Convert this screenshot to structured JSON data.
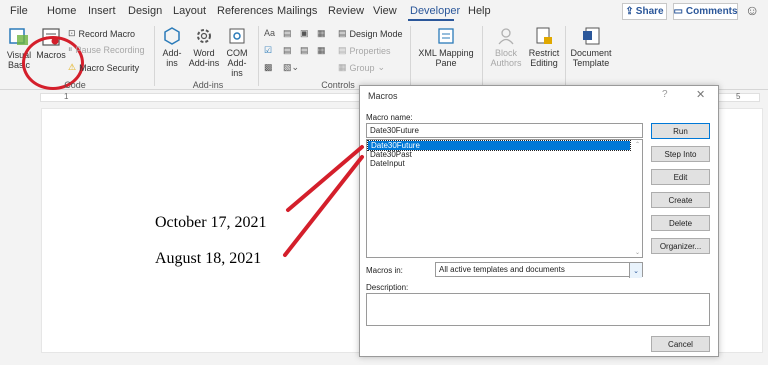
{
  "menu": {
    "items": [
      "File",
      "Home",
      "Insert",
      "Design",
      "Layout",
      "References",
      "Mailings",
      "Review",
      "View",
      "Developer",
      "Help"
    ],
    "active": "Developer",
    "share_label": "Share",
    "comments_label": "Comments"
  },
  "ribbon": {
    "visual_basic": "Visual Basic",
    "macros": "Macros",
    "record_macro": "Record Macro",
    "pause_recording": "Pause Recording",
    "macro_security": "Macro Security",
    "add_ins": "Add-ins",
    "word_add_ins": "Word Add-ins",
    "com_add_ins": "COM Add-ins",
    "design_mode": "Design Mode",
    "properties": "Properties",
    "group": "Group",
    "xml_mapping_pane": "XML Mapping Pane",
    "block_authors": "Block Authors",
    "restrict_editing": "Restrict Editing",
    "document_template": "Document Template",
    "group_labels": {
      "code": "Code",
      "add_ins": "Add-ins",
      "controls": "Controls"
    }
  },
  "ruler": {
    "left_num": "1",
    "right_num": "5"
  },
  "document": {
    "line1": "October 17, 2021",
    "line2": "August 18, 2021"
  },
  "dialog": {
    "title": "Macros",
    "help": "?",
    "close": "✕",
    "macro_name_label": "Macro name:",
    "macro_name_value": "Date30Future",
    "macros": [
      "Date30Future",
      "Date30Past",
      "DateInput"
    ],
    "selected_index": 0,
    "macros_in_label": "Macros in:",
    "macros_in_value": "All active templates and documents",
    "description_label": "Description:",
    "buttons": {
      "run": "Run",
      "step_into": "Step Into",
      "edit": "Edit",
      "create": "Create",
      "delete": "Delete",
      "organizer": "Organizer...",
      "cancel": "Cancel"
    }
  },
  "colors": {
    "accent": "#2b579a",
    "highlight": "#0078d7",
    "annotation": "#d41f2b"
  }
}
